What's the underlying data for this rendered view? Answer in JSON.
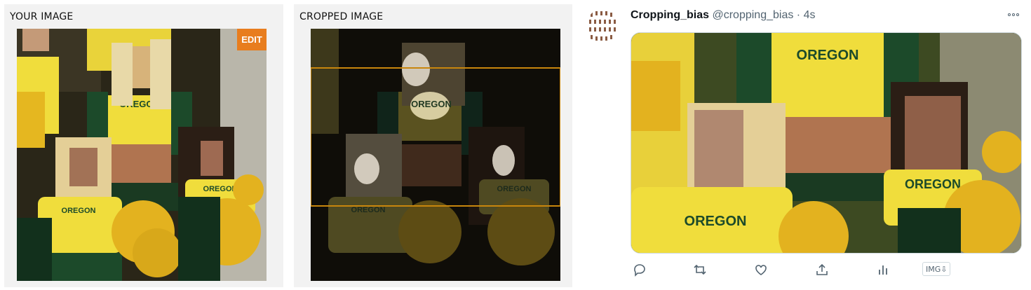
{
  "left_panel": {
    "label": "YOUR IMAGE",
    "edit_label": "EDIT",
    "shirt_text": "OREGON"
  },
  "mid_panel": {
    "label": "CROPPED IMAGE",
    "shirt_text": "OREGON"
  },
  "tweet": {
    "name": "Cropping_bias",
    "handle": "@cropping_bias",
    "separator": "·",
    "time": "4s",
    "shirt_text": "OREGON",
    "actions": [
      "reply-icon",
      "retweet-icon",
      "like-icon",
      "share-icon",
      "analytics-icon"
    ],
    "img_chip": "IMG⇩"
  },
  "colors": {
    "accent": "#e87d1e",
    "crop_border": "#c8860d",
    "oregon_yellow": "#f2e33a",
    "oregon_green": "#1c4a2a"
  }
}
